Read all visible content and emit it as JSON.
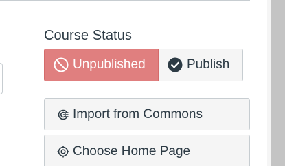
{
  "course_status": {
    "label": "Course Status",
    "unpublished_label": "Unpublished",
    "publish_label": "Publish",
    "unpublished_icon": "prohibited-icon",
    "publish_icon": "check-circle-icon",
    "active_state": "unpublished",
    "colors": {
      "unpublished_bg": "#e07f7f",
      "publish_bg": "#f5f5f5",
      "text_dark": "#2d3b45"
    }
  },
  "actions": [
    {
      "label": "Import from Commons",
      "icon": "commons-icon"
    },
    {
      "label": "Choose Home Page",
      "icon": "target-icon"
    }
  ]
}
